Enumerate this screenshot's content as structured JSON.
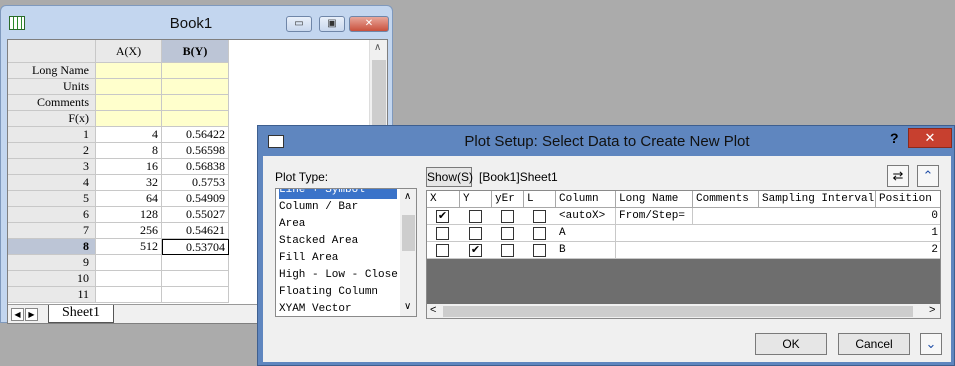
{
  "book": {
    "title": "Book1",
    "minimize": "▭",
    "restore": "▣",
    "close": "✕",
    "columns": [
      "A(X)",
      "B(Y)"
    ],
    "meta_rows": [
      "Long Name",
      "Units",
      "Comments",
      "F(x)"
    ],
    "rows": [
      {
        "n": "1",
        "a": "4",
        "b": "0.56422"
      },
      {
        "n": "2",
        "a": "8",
        "b": "0.56598"
      },
      {
        "n": "3",
        "a": "16",
        "b": "0.56838"
      },
      {
        "n": "4",
        "a": "32",
        "b": "0.5753"
      },
      {
        "n": "5",
        "a": "64",
        "b": "0.54909"
      },
      {
        "n": "6",
        "a": "128",
        "b": "0.55027"
      },
      {
        "n": "7",
        "a": "256",
        "b": "0.54621"
      },
      {
        "n": "8",
        "a": "512",
        "b": "0.53704"
      },
      {
        "n": "9",
        "a": "",
        "b": ""
      },
      {
        "n": "10",
        "a": "",
        "b": ""
      },
      {
        "n": "11",
        "a": "",
        "b": ""
      }
    ],
    "sheet_tab": "Sheet1"
  },
  "dialog": {
    "title": "Plot Setup: Select Data to Create New Plot",
    "help": "?",
    "close": "✕",
    "plot_type_label": "Plot Type:",
    "plot_types": [
      "Line + Symbol",
      "Column / Bar",
      "Area",
      "Stacked Area",
      "Fill Area",
      "High - Low - Close",
      "Floating Column",
      "XYAM Vector"
    ],
    "show_button": "Show(S)",
    "sheet_label": "[Book1]Sheet1",
    "headers": [
      "X",
      "Y",
      "yEr",
      "L",
      "Column",
      "Long Name",
      "Comments",
      "Sampling Interval",
      "Position"
    ],
    "rows": [
      {
        "x": true,
        "y": false,
        "column": "<autoX>",
        "long_name": "From/Step=",
        "position": "0"
      },
      {
        "x": false,
        "y": false,
        "column": "A",
        "long_name": "",
        "position": "1"
      },
      {
        "x": false,
        "y": true,
        "column": "B",
        "long_name": "",
        "position": "2"
      }
    ],
    "ok": "OK",
    "cancel": "Cancel"
  }
}
